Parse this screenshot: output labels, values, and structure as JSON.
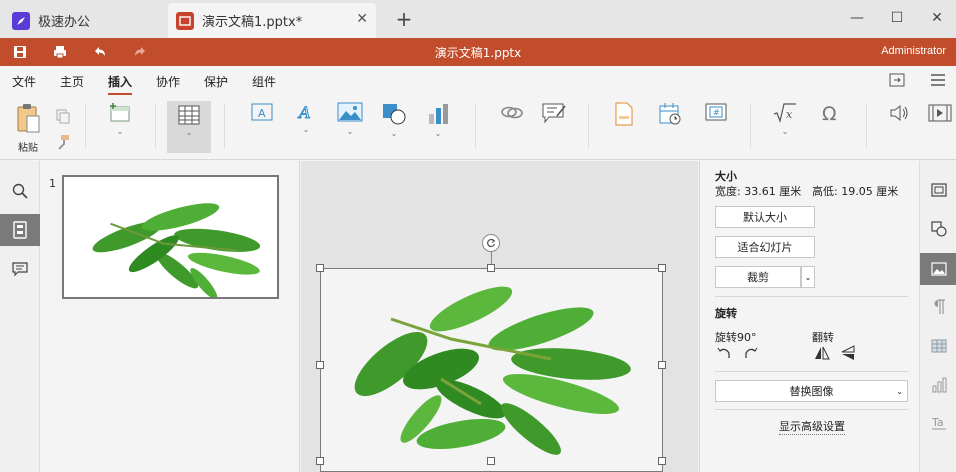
{
  "tabs": {
    "home_label": "极速办公",
    "doc_label": "演示文稿1.pptx*",
    "close": "✕",
    "new_tab": "+"
  },
  "window": {
    "minimize": "—",
    "maximize": "☐",
    "close": "✕"
  },
  "titlebar": {
    "title": "演示文稿1.pptx",
    "user": "Administrator",
    "color": "#c24d2c"
  },
  "menu": [
    "文件",
    "主页",
    "插入",
    "协作",
    "保护",
    "组件"
  ],
  "menu_active": "插入",
  "toolbar": {
    "paste_label": "粘贴"
  },
  "slides": {
    "number": "1"
  },
  "props": {
    "size_title": "大小",
    "width_text": "宽度: 33.61 厘米",
    "height_text": "高低: 19.05 厘米",
    "default_size": "默认大小",
    "fit_slide": "适合幻灯片",
    "crop": "裁剪",
    "rotate_title": "旋转",
    "rotate90": "旋转90°",
    "flip": "翻转",
    "replace_image": "替换图像",
    "advanced": "显示高级设置"
  }
}
